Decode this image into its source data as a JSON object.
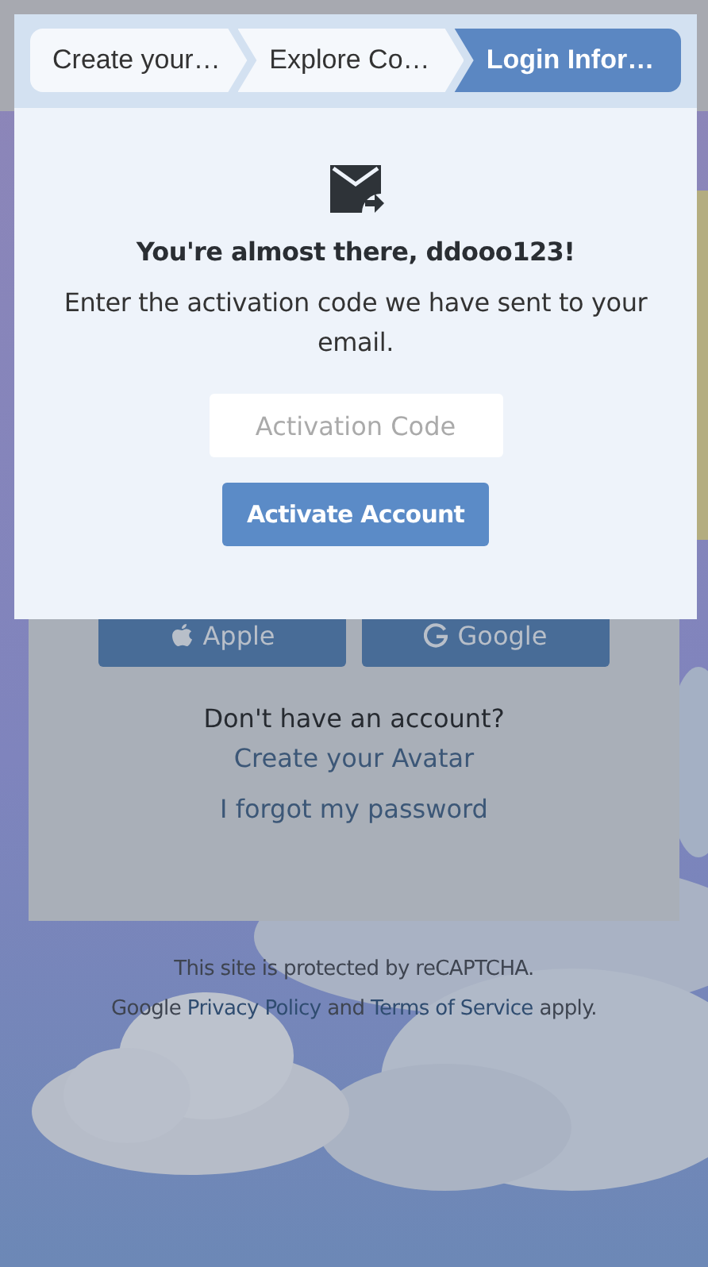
{
  "steps": [
    {
      "label": "Create your…",
      "selected": false
    },
    {
      "label": "Explore Co…",
      "selected": false
    },
    {
      "label": "Login Infor…",
      "selected": true
    }
  ],
  "activation": {
    "heading": "You're almost there, ddooo123!",
    "message": "Enter the activation code we have sent to your email.",
    "code_field": {
      "placeholder": "Activation Code"
    },
    "submit_button": "Activate Account"
  },
  "login_card": {
    "social_buttons": [
      {
        "kind": "apple",
        "label": "Apple"
      },
      {
        "kind": "google",
        "label": "Google"
      }
    ],
    "signup_prompt": {
      "text": "Don't have an account?",
      "link": "Create your Avatar"
    },
    "forgot_link": "I forgot my password"
  },
  "recaptcha_notice": {
    "line_1": "This site is protected by reCAPTCHA.",
    "text_1": "Google",
    "privacy_link": "Privacy Policy",
    "text_2": "and",
    "terms_link": "Terms of Service",
    "text_3": "apply."
  }
}
